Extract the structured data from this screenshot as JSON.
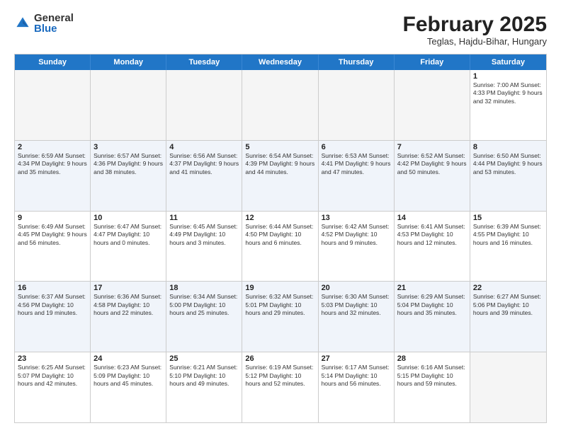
{
  "logo": {
    "general": "General",
    "blue": "Blue"
  },
  "title": "February 2025",
  "location": "Teglas, Hajdu-Bihar, Hungary",
  "header_days": [
    "Sunday",
    "Monday",
    "Tuesday",
    "Wednesday",
    "Thursday",
    "Friday",
    "Saturday"
  ],
  "rows": [
    [
      {
        "day": "",
        "info": "",
        "empty": true
      },
      {
        "day": "",
        "info": "",
        "empty": true
      },
      {
        "day": "",
        "info": "",
        "empty": true
      },
      {
        "day": "",
        "info": "",
        "empty": true
      },
      {
        "day": "",
        "info": "",
        "empty": true
      },
      {
        "day": "",
        "info": "",
        "empty": true
      },
      {
        "day": "1",
        "info": "Sunrise: 7:00 AM\nSunset: 4:33 PM\nDaylight: 9 hours\nand 32 minutes.",
        "empty": false
      }
    ],
    [
      {
        "day": "2",
        "info": "Sunrise: 6:59 AM\nSunset: 4:34 PM\nDaylight: 9 hours\nand 35 minutes.",
        "empty": false
      },
      {
        "day": "3",
        "info": "Sunrise: 6:57 AM\nSunset: 4:36 PM\nDaylight: 9 hours\nand 38 minutes.",
        "empty": false
      },
      {
        "day": "4",
        "info": "Sunrise: 6:56 AM\nSunset: 4:37 PM\nDaylight: 9 hours\nand 41 minutes.",
        "empty": false
      },
      {
        "day": "5",
        "info": "Sunrise: 6:54 AM\nSunset: 4:39 PM\nDaylight: 9 hours\nand 44 minutes.",
        "empty": false
      },
      {
        "day": "6",
        "info": "Sunrise: 6:53 AM\nSunset: 4:41 PM\nDaylight: 9 hours\nand 47 minutes.",
        "empty": false
      },
      {
        "day": "7",
        "info": "Sunrise: 6:52 AM\nSunset: 4:42 PM\nDaylight: 9 hours\nand 50 minutes.",
        "empty": false
      },
      {
        "day": "8",
        "info": "Sunrise: 6:50 AM\nSunset: 4:44 PM\nDaylight: 9 hours\nand 53 minutes.",
        "empty": false
      }
    ],
    [
      {
        "day": "9",
        "info": "Sunrise: 6:49 AM\nSunset: 4:45 PM\nDaylight: 9 hours\nand 56 minutes.",
        "empty": false
      },
      {
        "day": "10",
        "info": "Sunrise: 6:47 AM\nSunset: 4:47 PM\nDaylight: 10 hours\nand 0 minutes.",
        "empty": false
      },
      {
        "day": "11",
        "info": "Sunrise: 6:45 AM\nSunset: 4:49 PM\nDaylight: 10 hours\nand 3 minutes.",
        "empty": false
      },
      {
        "day": "12",
        "info": "Sunrise: 6:44 AM\nSunset: 4:50 PM\nDaylight: 10 hours\nand 6 minutes.",
        "empty": false
      },
      {
        "day": "13",
        "info": "Sunrise: 6:42 AM\nSunset: 4:52 PM\nDaylight: 10 hours\nand 9 minutes.",
        "empty": false
      },
      {
        "day": "14",
        "info": "Sunrise: 6:41 AM\nSunset: 4:53 PM\nDaylight: 10 hours\nand 12 minutes.",
        "empty": false
      },
      {
        "day": "15",
        "info": "Sunrise: 6:39 AM\nSunset: 4:55 PM\nDaylight: 10 hours\nand 16 minutes.",
        "empty": false
      }
    ],
    [
      {
        "day": "16",
        "info": "Sunrise: 6:37 AM\nSunset: 4:56 PM\nDaylight: 10 hours\nand 19 minutes.",
        "empty": false
      },
      {
        "day": "17",
        "info": "Sunrise: 6:36 AM\nSunset: 4:58 PM\nDaylight: 10 hours\nand 22 minutes.",
        "empty": false
      },
      {
        "day": "18",
        "info": "Sunrise: 6:34 AM\nSunset: 5:00 PM\nDaylight: 10 hours\nand 25 minutes.",
        "empty": false
      },
      {
        "day": "19",
        "info": "Sunrise: 6:32 AM\nSunset: 5:01 PM\nDaylight: 10 hours\nand 29 minutes.",
        "empty": false
      },
      {
        "day": "20",
        "info": "Sunrise: 6:30 AM\nSunset: 5:03 PM\nDaylight: 10 hours\nand 32 minutes.",
        "empty": false
      },
      {
        "day": "21",
        "info": "Sunrise: 6:29 AM\nSunset: 5:04 PM\nDaylight: 10 hours\nand 35 minutes.",
        "empty": false
      },
      {
        "day": "22",
        "info": "Sunrise: 6:27 AM\nSunset: 5:06 PM\nDaylight: 10 hours\nand 39 minutes.",
        "empty": false
      }
    ],
    [
      {
        "day": "23",
        "info": "Sunrise: 6:25 AM\nSunset: 5:07 PM\nDaylight: 10 hours\nand 42 minutes.",
        "empty": false
      },
      {
        "day": "24",
        "info": "Sunrise: 6:23 AM\nSunset: 5:09 PM\nDaylight: 10 hours\nand 45 minutes.",
        "empty": false
      },
      {
        "day": "25",
        "info": "Sunrise: 6:21 AM\nSunset: 5:10 PM\nDaylight: 10 hours\nand 49 minutes.",
        "empty": false
      },
      {
        "day": "26",
        "info": "Sunrise: 6:19 AM\nSunset: 5:12 PM\nDaylight: 10 hours\nand 52 minutes.",
        "empty": false
      },
      {
        "day": "27",
        "info": "Sunrise: 6:17 AM\nSunset: 5:14 PM\nDaylight: 10 hours\nand 56 minutes.",
        "empty": false
      },
      {
        "day": "28",
        "info": "Sunrise: 6:16 AM\nSunset: 5:15 PM\nDaylight: 10 hours\nand 59 minutes.",
        "empty": false
      },
      {
        "day": "",
        "info": "",
        "empty": true
      }
    ]
  ]
}
